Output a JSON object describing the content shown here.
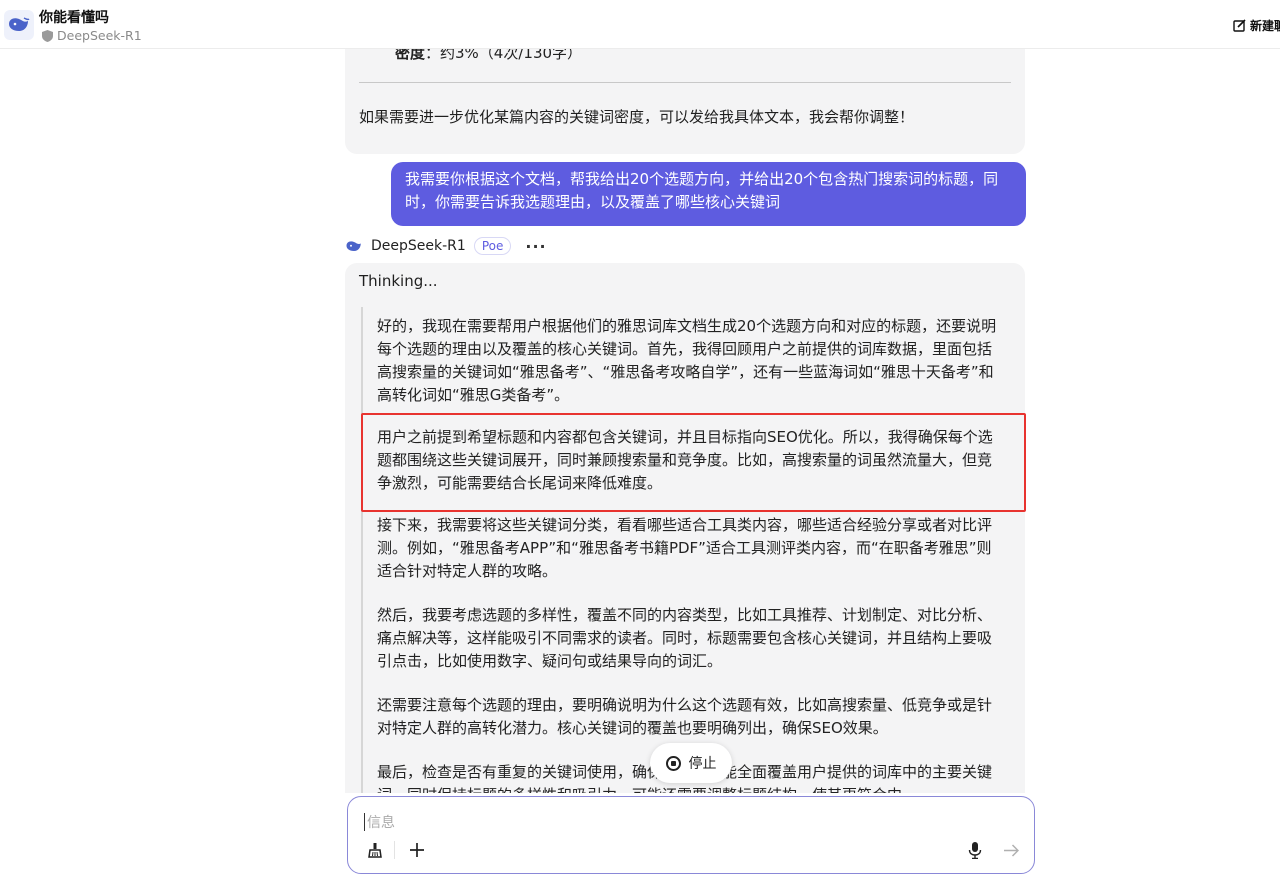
{
  "header": {
    "chat_title": "你能看懂吗",
    "bot_name": "DeepSeek-R1",
    "new_chat_label": "新建聊",
    "colors": {
      "accent": "#5e5ce0",
      "logo": "#4a63c9"
    }
  },
  "previous_message": {
    "density_label": "密度",
    "density_value": "：约3%（4次/130字）",
    "footer_text": "如果需要进一步优化某篇内容的关键词密度，可以发给我具体文本，我会帮你调整！"
  },
  "user_message": {
    "text": "我需要你根据这个文档，帮我给出20个选题方向，并给出20个包含热门搜索词的标题，同时，你需要告诉我选题理由，以及覆盖了哪些核心关键词"
  },
  "bot_message": {
    "name": "DeepSeek-R1",
    "badge": "Poe",
    "more_icon": "ellipsis-icon",
    "thinking_label": "Thinking...",
    "paragraphs": [
      "好的，我现在需要帮用户根据他们的雅思词库文档生成20个选题方向和对应的标题，还要说明每个选题的理由以及覆盖的核心关键词。首先，我得回顾用户之前提供的词库数据，里面包括高搜索量的关键词如“雅思备考”、“雅思备考攻略自学”，还有一些蓝海词如“雅思十天备考”和高转化词如“雅思G类备考”。",
      "用户之前提到希望标题和内容都包含关键词，并且目标指向SEO优化。所以，我得确保每个选题都围绕这些关键词展开，同时兼顾搜索量和竞争度。比如，高搜索量的词虽然流量大，但竞争激烈，可能需要结合长尾词来降低难度。",
      "接下来，我需要将这些关键词分类，看看哪些适合工具类内容，哪些适合经验分享或者对比评测。例如，“雅思备考APP”和“雅思备考书籍PDF”适合工具测评类内容，而“在职备考雅思”则适合针对特定人群的攻略。",
      "然后，我要考虑选题的多样性，覆盖不同的内容类型，比如工具推荐、计划制定、对比分析、痛点解决等，这样能吸引不同需求的读者。同时，标题需要包含核心关键词，并且结构上要吸引点击，比如使用数字、疑问句或结果导向的词汇。",
      "还需要注意每个选题的理由，要明确说明为什么这个选题有效，比如高搜索量、低竞争或是针对特定人群的高转化潜力。核心关键词的覆盖也要明确列出，确保SEO效果。",
      "最后，检查是否有重复的关键词使用，确保每个选题能全面覆盖用户提供的词库中的主要关键词，同时保持标题的多样性和吸引力。可能还需要调整标题结构，使其更符合中"
    ]
  },
  "stop_button": {
    "label": "停止",
    "icon": "stop-circle-icon"
  },
  "composer": {
    "placeholder": "信息",
    "value": "",
    "icons": [
      "broom-icon",
      "plus-icon",
      "microphone-icon",
      "send-arrow-icon"
    ]
  }
}
